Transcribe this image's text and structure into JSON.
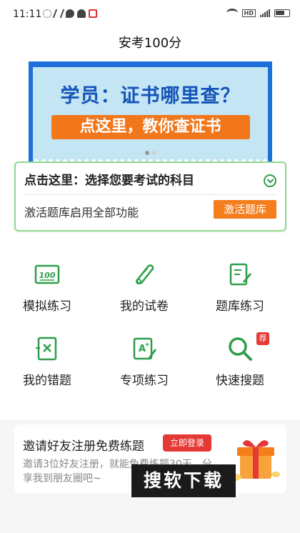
{
  "status_bar": {
    "time": "11:11",
    "left_icons": [
      "loading-icon",
      "vv-icon",
      "chat-icon",
      "bell-icon",
      "app-red-icon"
    ],
    "right_icons": [
      "wifi-icon",
      "hd-icon",
      "signal-icon",
      "battery-icon"
    ],
    "hd_label": "HD"
  },
  "header": {
    "title": "安考100分"
  },
  "banner": {
    "line1": "学员：证书哪里查？",
    "line2": "点这里，教你查证书",
    "colors": {
      "frame": "#1f6fd9",
      "bg": "#c4e6f4",
      "accent": "#f2761a"
    }
  },
  "subject_card": {
    "title": "点击这里：选择您要考试的科目",
    "hint": "激活题库启用全部功能",
    "activate_label": "激活题库"
  },
  "features": [
    {
      "label": "模拟练习",
      "icon": "exam-100-icon"
    },
    {
      "label": "我的试卷",
      "icon": "scroll-icon"
    },
    {
      "label": "题库练习",
      "icon": "edit-document-icon"
    },
    {
      "label": "我的错题",
      "icon": "wrong-answer-icon"
    },
    {
      "label": "专项练习",
      "icon": "a-plus-icon"
    },
    {
      "label": "快速搜题",
      "icon": "search-icon"
    }
  ],
  "recommend_badge": "荐",
  "invite": {
    "title": "邀请好友注册免费练题",
    "login_label": "立即登录",
    "desc": "邀请3位好友注册，就能免费练题30天，分享我到朋友圈吧~"
  },
  "watermark": "搜软下载",
  "theme": {
    "green": "#2e9e4a",
    "orange": "#f47d1c",
    "red": "#e53935"
  }
}
